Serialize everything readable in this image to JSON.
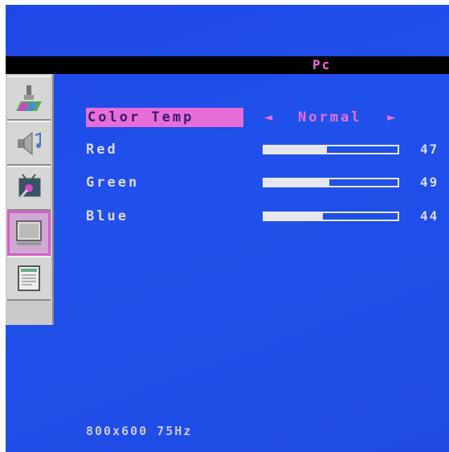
{
  "title": "Pc",
  "sidebar": {
    "tabs": [
      {
        "name": "picture",
        "icon": "paint-brush-icon",
        "active": false
      },
      {
        "name": "sound",
        "icon": "speaker-icon",
        "active": false
      },
      {
        "name": "tv-setup",
        "icon": "tv-tools-icon",
        "active": false
      },
      {
        "name": "pc",
        "icon": "monitor-icon",
        "active": true
      },
      {
        "name": "options",
        "icon": "document-icon",
        "active": false
      }
    ]
  },
  "color_temp": {
    "label": "Color Temp",
    "value": "Normal",
    "left_arrow": "◄",
    "right_arrow": "►"
  },
  "sliders": [
    {
      "label": "Red",
      "value": "47",
      "level": 47
    },
    {
      "label": "Green",
      "value": "49",
      "level": 49
    },
    {
      "label": "Blue",
      "value": "44",
      "level": 44
    }
  ],
  "status": {
    "resolution": "800x600 75Hz"
  },
  "colors": {
    "background": "#1f4be4",
    "highlight": "#e76ed9",
    "title_bar": "#000000",
    "sidebar": "#c9c9c9"
  }
}
